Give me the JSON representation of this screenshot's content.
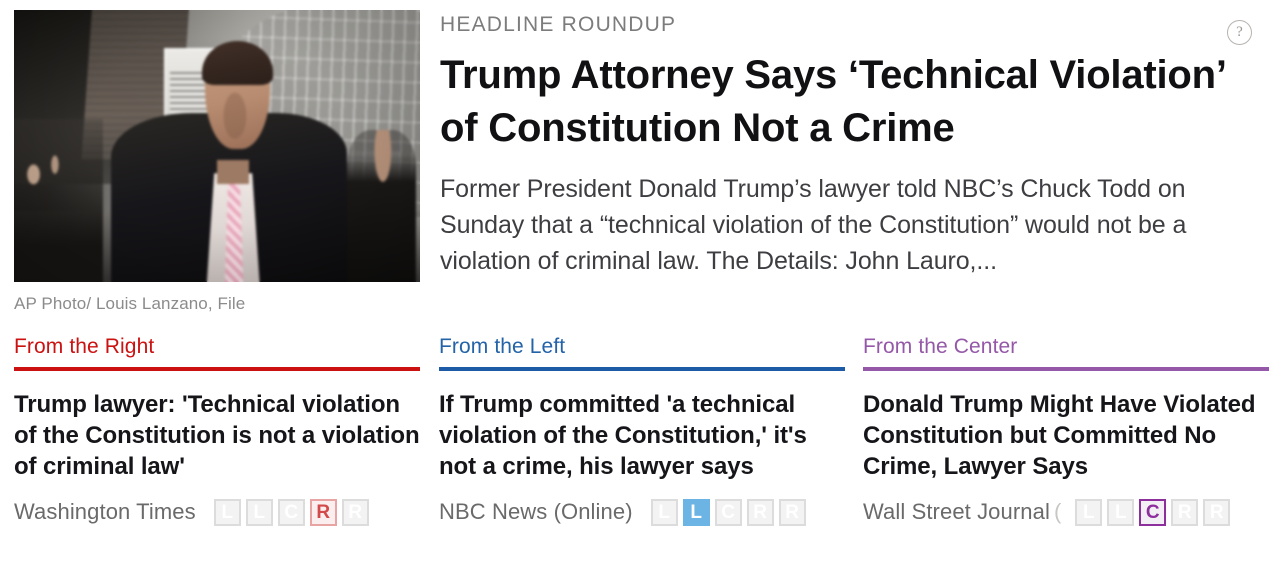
{
  "header": {
    "kicker": "HEADLINE ROUNDUP",
    "help_icon_label": "?",
    "headline": "Trump Attorney Says ‘Technical Violation’ of Constitution Not a Crime",
    "summary": "Former President Donald Trump’s lawyer told NBC’s Chuck Todd on Sunday that a “technical violation of the Constitution” would not be a violation of criminal law.  The Details: John Lauro,..."
  },
  "photo": {
    "credit": "AP Photo/ Louis Lanzano, File",
    "alt": "Man in dark suit with pink tie walking outside a courthouse"
  },
  "colors": {
    "right": "#cc1111",
    "left": "#1e5ba6",
    "center": "#9558a8",
    "bias_left_fill": "#6cb4e4",
    "bias_center_border": "#8e2f9e",
    "bias_right_border": "#e8a3a3",
    "bias_inactive": "#dcdcdc"
  },
  "bias_scale": [
    "L",
    "L",
    "C",
    "R",
    "R"
  ],
  "columns": [
    {
      "key": "right",
      "title": "From the Right",
      "headline": "Trump lawyer: 'Technical violation of the Constitution is not a violation of criminal law'",
      "source": "Washington Times",
      "source_suffix": "",
      "bias_active_index": 3,
      "bias_active_kind": "right"
    },
    {
      "key": "left",
      "title": "From the Left",
      "headline": "If Trump committed 'a technical violation of the Constitution,' it's not a crime, his lawyer says",
      "source": "NBC News (Online)",
      "source_suffix": "",
      "bias_active_index": 1,
      "bias_active_kind": "left"
    },
    {
      "key": "center",
      "title": "From the Center",
      "headline": "Donald Trump Might Have Violated Constitution but Committed No Crime, Lawyer Says",
      "source": "Wall Street Journal",
      "source_suffix": "(",
      "bias_active_index": 2,
      "bias_active_kind": "center"
    }
  ]
}
